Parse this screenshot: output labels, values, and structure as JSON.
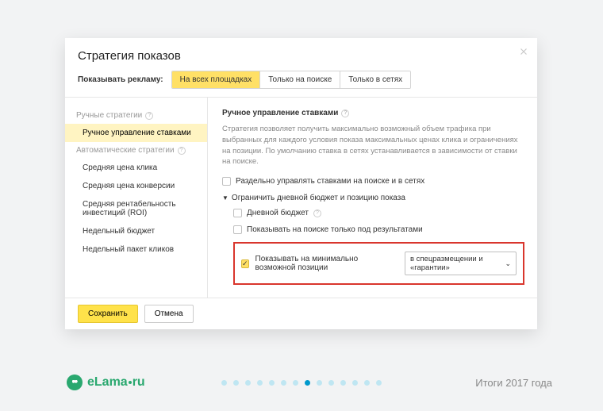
{
  "dialog": {
    "title": "Стратегия показов",
    "tabs": {
      "label": "Показывать рекламу:",
      "items": [
        "На всех площадках",
        "Только на поиске",
        "Только в сетях"
      ],
      "activeIndex": 0
    }
  },
  "sidebar": {
    "group1": {
      "header": "Ручные стратегии",
      "items": [
        "Ручное управление ставками"
      ],
      "activeIndex": 0
    },
    "group2": {
      "header": "Автоматические стратегии",
      "items": [
        "Средняя цена клика",
        "Средняя цена конверсии",
        "Средняя рентабельность инвестиций (ROI)",
        "Недельный бюджет",
        "Недельный пакет кликов"
      ]
    }
  },
  "content": {
    "title": "Ручное управление ставками",
    "description": "Стратегия позволяет получить максимально возможный объем трафика при выбранных для каждого условия показа максимальных ценах клика и ограничениях на позиции. По умолчанию ставка в сетях устанавливается в зависимости от ставки на поиске.",
    "checkbox_separate": "Раздельно управлять ставками на поиске и в сетях",
    "collapser": "Ограничить дневной бюджет и позицию показа",
    "checkbox_budget": "Дневной бюджет",
    "checkbox_below": "Показывать на поиске только под результатами",
    "highlight": {
      "label": "Показывать на минимально возможной позиции",
      "dropdown": "в спецразмещении и «гарантии»"
    }
  },
  "footer_buttons": {
    "save": "Сохранить",
    "cancel": "Отмена"
  },
  "page_footer": {
    "logo_prefix": "eLama",
    "logo_suffix": "ru",
    "caption": "Итоги 2017 года",
    "dots_total": 14,
    "dots_active": 7
  },
  "help_symbol": "?"
}
